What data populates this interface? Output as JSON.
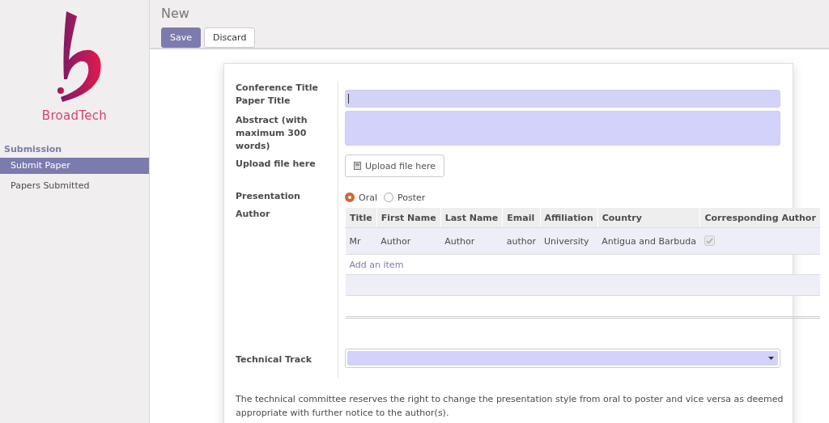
{
  "brand": {
    "name": "BroadTech"
  },
  "sidebar": {
    "section": "Submission",
    "items": [
      {
        "label": "Submit Paper",
        "selected": true
      },
      {
        "label": "Papers Submitted",
        "selected": false
      }
    ]
  },
  "header": {
    "title": "New",
    "buttons": [
      {
        "label": "Save",
        "kind": "primary"
      },
      {
        "label": "Discard",
        "kind": "secondary"
      }
    ]
  },
  "form": {
    "conference_title_label": "Conference Title",
    "paper_title": {
      "label": "Paper Title"
    },
    "abstract": {
      "label": "Abstract (with maximum 300 words)"
    },
    "upload": {
      "label": "Upload file here",
      "button": "Upload file here"
    },
    "presentation": {
      "label": "Presentation",
      "options": [
        {
          "label": "Oral",
          "selected": true
        },
        {
          "label": "Poster",
          "selected": false
        }
      ]
    },
    "author": {
      "label": "Author",
      "columns": [
        "Title",
        "First Name",
        "Last Name",
        "Email",
        "Affiliation",
        "Country",
        "Corresponding Author"
      ],
      "rows": [
        {
          "cells": [
            "Mr",
            "Author",
            "Author",
            "author",
            "University",
            "Antigua and Barbuda"
          ],
          "corresponding": true
        }
      ],
      "add_item": "Add an item"
    },
    "technical_track": {
      "label": "Technical Track"
    },
    "note": "The technical committee reserves the right to change the presentation style from oral to poster and vice versa as deemed appropriate with further notice to the author(s)."
  }
}
